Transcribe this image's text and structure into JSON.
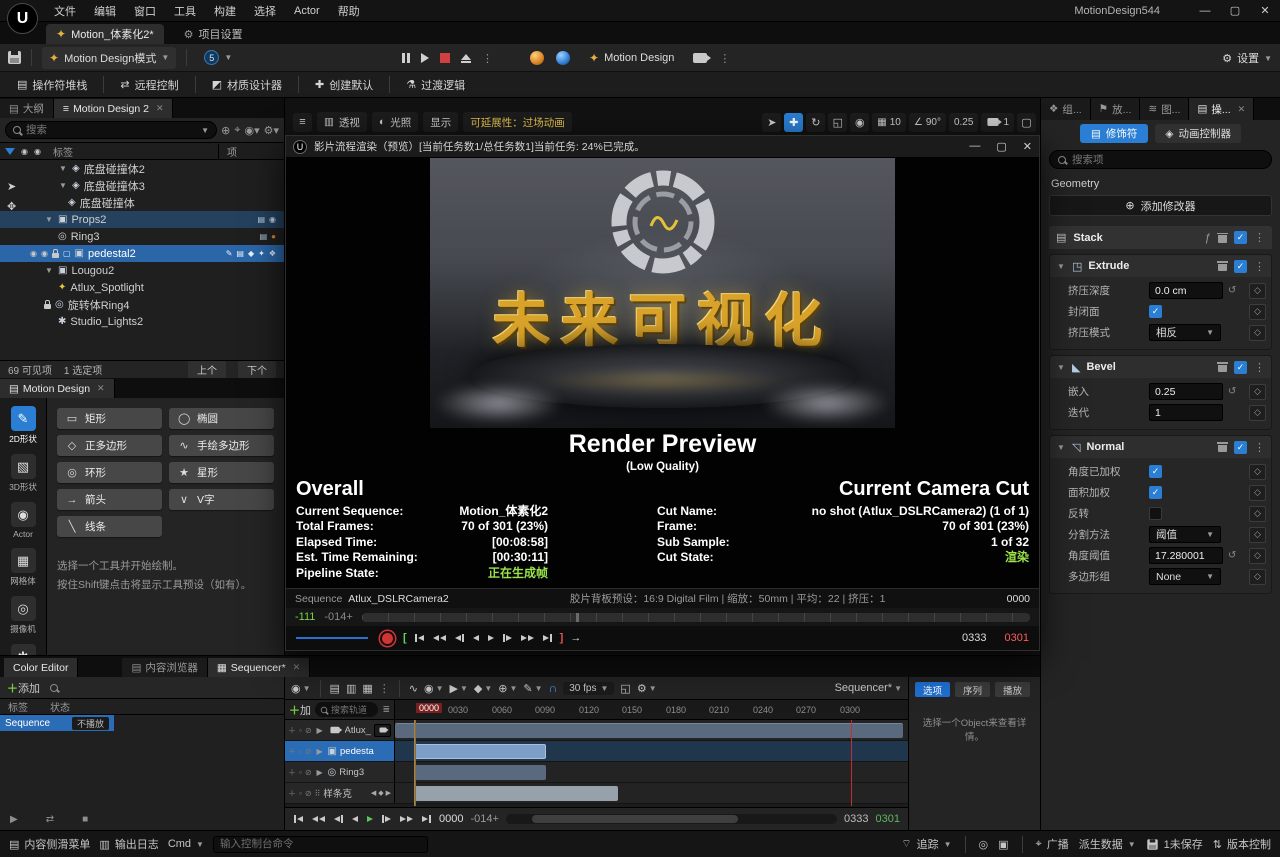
{
  "app": {
    "title": "MotionDesign544"
  },
  "menu": {
    "items": [
      "文件",
      "编辑",
      "窗口",
      "工具",
      "构建",
      "选择",
      "Actor",
      "帮助"
    ]
  },
  "doc_tabs": {
    "main": "Motion_体素化2*",
    "project_settings": "项目设置"
  },
  "toolbar": {
    "mode": "Motion Design模式",
    "five": "5",
    "motion_design": "Motion Design",
    "settings": "设置"
  },
  "toolbar2": {
    "items": [
      "操作符堆栈",
      "远程控制",
      "材质设计器",
      "创建默认",
      "过渡逻辑"
    ]
  },
  "outliner": {
    "tab_a": "大纲",
    "tab_b": "Motion Design 2",
    "search": "搜索",
    "col_tag": "标签",
    "col_item": "项",
    "rows": [
      "底盘碰撞体2",
      "底盘碰撞体3",
      "底盘碰撞体",
      "Props2",
      "Ring3",
      "pedestal2",
      "Lougou2",
      "Atlux_Spotlight",
      "旋转体Ring4",
      "Studio_Lights2"
    ],
    "footer_visible": "69 可见项",
    "footer_selected": "1 选定项",
    "prev": "上个",
    "next": "下个"
  },
  "shapes": {
    "tab": "Motion Design",
    "categories": [
      "2D形状",
      "3D形状",
      "Actor",
      "网格体",
      "摄像机",
      "光源"
    ],
    "tools": [
      "矩形",
      "椭圆",
      "正多边形",
      "手绘多边形",
      "环形",
      "星形",
      "箭头",
      "V字",
      "线条"
    ],
    "hint1": "选择一个工具并开始绘制。",
    "hint2": "按住Shift键点击将显示工具预设（如有）。"
  },
  "viewport": {
    "perspective": "透视",
    "lit": "光照",
    "show": "显示",
    "scalability": "可延展性：过场动画",
    "grid": "10",
    "angle": "90°",
    "scale": "0.25",
    "cam": "1"
  },
  "render": {
    "title": "影片流程渲染（预览）[当前任务数1/总任务数1]当前任务: 24%已完成。",
    "scene_text": "未来可视化",
    "heading": "Render Preview",
    "subheading": "(Low Quality)",
    "overall_title": "Overall",
    "overall_rows": [
      {
        "label": "Current Sequence:",
        "value": "Motion_体素化2"
      },
      {
        "label": "Total Frames:",
        "value": "70 of 301 (23%)"
      },
      {
        "label": "Elapsed Time:",
        "value": "[00:08:58]"
      },
      {
        "label": "Est. Time Remaining:",
        "value": "[00:30:11]"
      },
      {
        "label": "Pipeline State:",
        "value": "正在生成帧"
      }
    ],
    "cut_title": "Current Camera Cut",
    "cut_rows": [
      {
        "label": "Cut Name:",
        "value": "no shot (Atlux_DSLRCamera2) (1 of 1)"
      },
      {
        "label": "Frame:",
        "value": "70 of 301 (23%)"
      },
      {
        "label": "Sub Sample:",
        "value": "1 of 32"
      },
      {
        "label": "Cut State:",
        "value": "渲染"
      }
    ],
    "footer": {
      "sequence_label": "Sequence",
      "sequence_name": "Atlux_DSLRCamera2",
      "filmback": "胶片背板预设：16:9 Digital Film | 缩放：50mm | 平均：22 | 挤压：1",
      "frame": "0000"
    },
    "timeline": {
      "in_green": "-111",
      "in_grey": "-014+",
      "out_white": "0333",
      "out_red": "0301"
    }
  },
  "details": {
    "tabs": [
      "组...",
      "放...",
      "图...",
      "操..."
    ],
    "modifiers_button": "修饰符",
    "animators_button": "动画控制器",
    "search": "搜索项",
    "section": "Geometry",
    "add_modifier": "添加修改器",
    "stack": "Stack",
    "extrude": {
      "name": "Extrude",
      "depth_label": "挤压深度",
      "depth_value": "0.0 cm",
      "close_label": "封闭面",
      "mode_label": "挤压模式",
      "mode_value": "相反"
    },
    "bevel": {
      "name": "Bevel",
      "inset_label": "嵌入",
      "inset_value": "0.25",
      "iter_label": "迭代",
      "iter_value": "1"
    },
    "normal": {
      "name": "Normal",
      "aw_label": "角度已加权",
      "area_label": "面积加权",
      "inv_label": "反转",
      "split_label": "分割方法",
      "split_value": "阈值",
      "angle_label": "角度阈值",
      "angle_value": "17.280001",
      "poly_label": "多边形组",
      "poly_value": "None"
    }
  },
  "color_editor": {
    "tab": "Color Editor",
    "add": "添加",
    "col_tag": "标签",
    "col_status": "状态",
    "row_name": "Sequence",
    "row_status": "不播放"
  },
  "bottom_tabs": {
    "content_browser": "内容浏览器",
    "sequencer": "Sequencer*"
  },
  "sequencer": {
    "fps": "30 fps",
    "corner": "Sequencer*",
    "buttons": [
      "选项",
      "序列",
      "播放"
    ],
    "hint": "选择一个Object来查看详情。",
    "add": "加",
    "search": "搜索轨道",
    "playhead": "0000",
    "ruler": [
      "0030",
      "0060",
      "0090",
      "0120",
      "0150",
      "0180",
      "0210",
      "0240",
      "0270",
      "0300"
    ],
    "tracks": [
      "Atlux_DS",
      "pedesta",
      "Ring3",
      "样条克"
    ],
    "bottom": {
      "current": "0000",
      "view_start": "-014+",
      "view_end": "0333",
      "work_end": "0301"
    }
  },
  "statusbar": {
    "content_drawer": "内容侧滑菜单",
    "output_log": "输出日志",
    "cmd": "Cmd",
    "console": "输入控制台命令",
    "trace": "追踪",
    "broadcast": "广播",
    "ddc": "派生数据",
    "unsaved": "1未保存",
    "revision": "版本控制"
  }
}
